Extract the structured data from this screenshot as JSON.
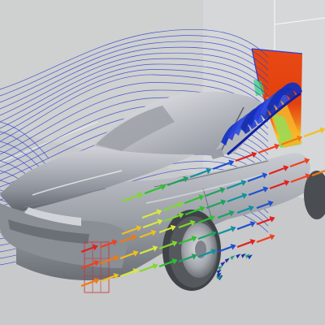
{
  "viewport": {
    "background": "#cfd0d0",
    "room_floor_color": "#c9cacb",
    "room_wall_color": "#d4d5d6",
    "room_edge_color": "#f2f2f2",
    "body_color": "#9a9ea6",
    "body_highlight": "#e8e9ec",
    "body_shadow": "#4d5158",
    "window_color": "#a3a7ae",
    "tire_color": "#5a5d62",
    "rim_color": "#a9adb3"
  },
  "streamlines": {
    "color": "#2a3fd0"
  },
  "pressure_plane": {
    "colors": [
      "#e03a10",
      "#f06a1c",
      "#f8c020",
      "#c0f03c",
      "#2fd080",
      "#2a7fd8"
    ]
  },
  "vortex": {
    "colors": [
      "#1030c0",
      "#2a40d8",
      "#3050e0",
      "#1c2fa8"
    ]
  },
  "vector_arrows": {
    "colors": [
      "#e02020",
      "#f04020",
      "#f07a10",
      "#f0c020",
      "#d8e840",
      "#80d830",
      "#30c030",
      "#20a060",
      "#1090a0",
      "#2050d0"
    ]
  },
  "probe_grid": {
    "color": "#d03030"
  }
}
